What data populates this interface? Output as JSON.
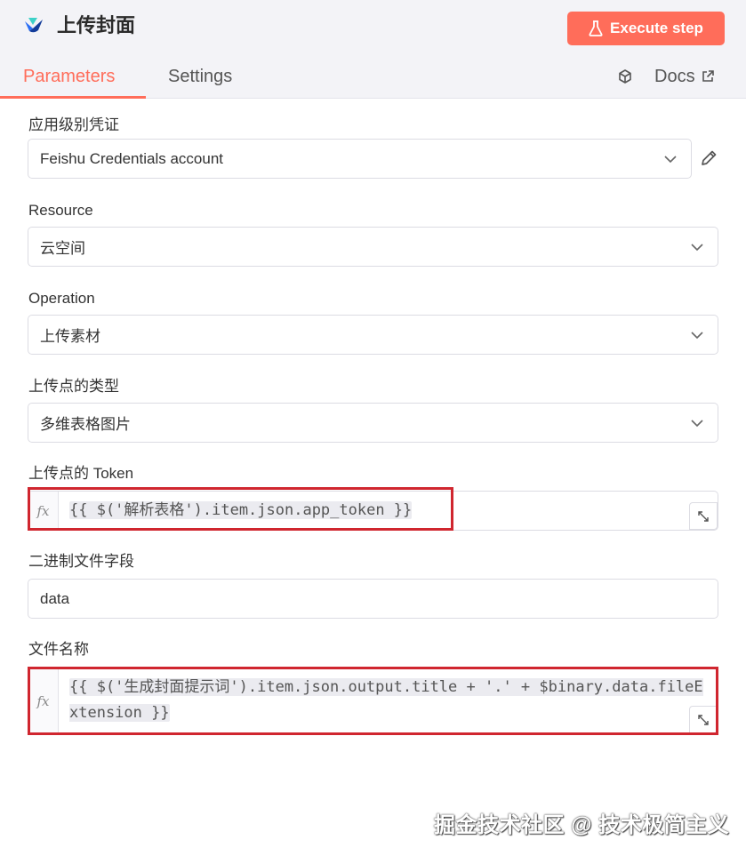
{
  "header": {
    "title": "上传封面",
    "execute_label": "Execute step"
  },
  "tabs": {
    "parameters": "Parameters",
    "settings": "Settings",
    "docs": "Docs"
  },
  "fields": {
    "credential": {
      "label": "应用级别凭证",
      "value": "Feishu Credentials account"
    },
    "resource": {
      "label": "Resource",
      "value": "云空间"
    },
    "operation": {
      "label": "Operation",
      "value": "上传素材"
    },
    "upload_type": {
      "label": "上传点的类型",
      "value": "多维表格图片"
    },
    "token": {
      "label": "上传点的 Token",
      "value": "{{ $('解析表格').item.json.app_token }}"
    },
    "binary_field": {
      "label": "二进制文件字段",
      "value": "data"
    },
    "file_name": {
      "label": "文件名称",
      "value": "{{ $('生成封面提示词').item.json.output.title + '.' + $binary.data.fileExtension }}"
    }
  },
  "fx_label": "fx",
  "watermark": "掘金技术社区 @ 技术极简主义",
  "colors": {
    "accent": "#ff6d5a",
    "highlight_box": "#d0262f"
  }
}
